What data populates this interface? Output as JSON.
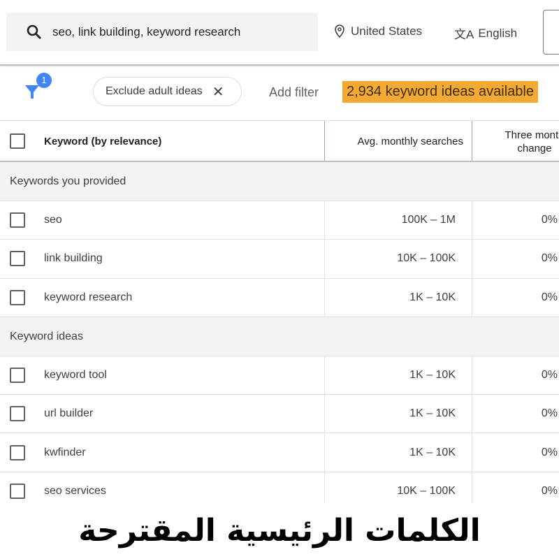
{
  "header": {
    "search_value": "seo, link building, keyword research",
    "location": "United States",
    "language": "English"
  },
  "filters": {
    "filter_count": "1",
    "chip_label": "Exclude adult ideas",
    "add_filter": "Add filter",
    "available": "2,934 keyword ideas available"
  },
  "table": {
    "columns": [
      "Keyword (by relevance)",
      "Avg. monthly searches",
      "Three month change"
    ],
    "groups": [
      {
        "label": "Keywords you provided",
        "rows": [
          {
            "keyword": "seo",
            "avg": "100K – 1M",
            "change": "0%"
          },
          {
            "keyword": "link building",
            "avg": "10K – 100K",
            "change": "0%"
          },
          {
            "keyword": "keyword research",
            "avg": "1K – 10K",
            "change": "0%"
          }
        ]
      },
      {
        "label": "Keyword ideas",
        "rows": [
          {
            "keyword": "keyword tool",
            "avg": "1K – 10K",
            "change": "0%"
          },
          {
            "keyword": "url builder",
            "avg": "1K – 10K",
            "change": "0%"
          },
          {
            "keyword": "kwfinder",
            "avg": "1K – 10K",
            "change": "0%"
          },
          {
            "keyword": "seo services",
            "avg": "10K – 100K",
            "change": "0%"
          }
        ]
      }
    ]
  },
  "caption": "الكلمات الرئيسية المقترحة",
  "colors": {
    "highlight": "#f4a932",
    "accent": "#4285f4"
  }
}
